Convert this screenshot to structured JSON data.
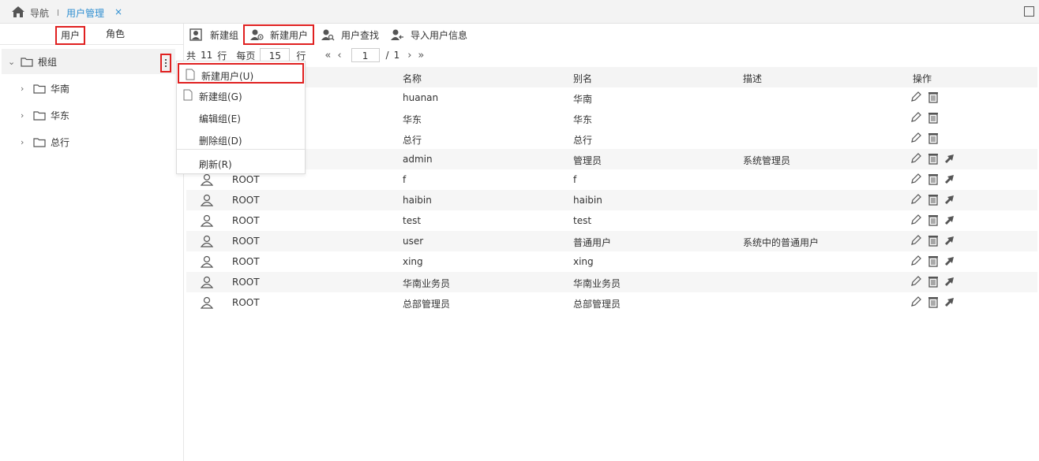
{
  "topbar": {
    "home_label": "导航",
    "active_tab": "用户管理",
    "close": "×"
  },
  "sidebar": {
    "tabs": [
      "用户",
      "角色"
    ],
    "root": "根组",
    "groups": [
      "华南",
      "华东",
      "总行"
    ]
  },
  "toolbar": {
    "new_group": "新建组",
    "new_user": "新建用户",
    "find_user": "用户查找",
    "import_users": "导入用户信息"
  },
  "pager": {
    "total_prefix": "共",
    "total": "11",
    "rows_unit": "行",
    "per_page_label": "每页",
    "per_page": "15",
    "page": "1",
    "pages_sep": "/",
    "pages": "1"
  },
  "table": {
    "headers": [
      "名称",
      "别名",
      "描述",
      "操作"
    ],
    "rows": [
      {
        "parent": "",
        "name": "huanan",
        "alias": "华南",
        "desc": ""
      },
      {
        "parent": "",
        "name": "华东",
        "alias": "华东",
        "desc": ""
      },
      {
        "parent": "",
        "name": "总行",
        "alias": "总行",
        "desc": ""
      },
      {
        "parent": "",
        "name": "admin",
        "alias": "管理员",
        "desc": "系统管理员"
      },
      {
        "parent": "ROOT",
        "name": "f",
        "alias": "f",
        "desc": ""
      },
      {
        "parent": "ROOT",
        "name": "haibin",
        "alias": "haibin",
        "desc": ""
      },
      {
        "parent": "ROOT",
        "name": "test",
        "alias": "test",
        "desc": ""
      },
      {
        "parent": "ROOT",
        "name": "user",
        "alias": "普通用户",
        "desc": "系统中的普通用户"
      },
      {
        "parent": "ROOT",
        "name": "xing",
        "alias": "xing",
        "desc": ""
      },
      {
        "parent": "ROOT",
        "name": "华南业务员",
        "alias": "华南业务员",
        "desc": ""
      },
      {
        "parent": "ROOT",
        "name": "总部管理员",
        "alias": "总部管理员",
        "desc": ""
      }
    ]
  },
  "context_menu": [
    "新建用户(U)",
    "新建组(G)",
    "编辑组(E)",
    "删除组(D)",
    "刷新(R)"
  ],
  "colors": {
    "accent": "#2f8fd1",
    "highlight": "#e02020"
  }
}
